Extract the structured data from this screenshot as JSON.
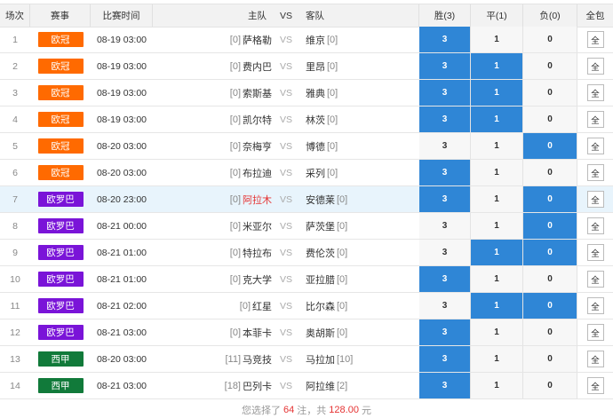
{
  "headers": {
    "index": "场次",
    "league": "赛事",
    "time": "比赛时间",
    "home": "主队",
    "vs": "VS",
    "away": "客队",
    "win": "胜(3)",
    "draw": "平(1)",
    "lose": "负(0)",
    "all": "全包"
  },
  "colors": {
    "ucl": "#ff6a00",
    "uel": "#7a14d8",
    "laliga": "#117a3a",
    "selected": "#2f86d6"
  },
  "rows": [
    {
      "idx": "1",
      "league": "欧冠",
      "lt": "ucl",
      "time": "08-19 03:00",
      "hr": "[0]",
      "home": "萨格勒",
      "away": "维京",
      "ar": "[0]",
      "win": "3",
      "draw": "1",
      "lose": "0",
      "all": "全",
      "sel": [
        true,
        false,
        false
      ],
      "hl": false,
      "red": false
    },
    {
      "idx": "2",
      "league": "欧冠",
      "lt": "ucl",
      "time": "08-19 03:00",
      "hr": "[0]",
      "home": "费内巴",
      "away": "里昂",
      "ar": "[0]",
      "win": "3",
      "draw": "1",
      "lose": "0",
      "all": "全",
      "sel": [
        true,
        true,
        false
      ],
      "hl": false,
      "red": false
    },
    {
      "idx": "3",
      "league": "欧冠",
      "lt": "ucl",
      "time": "08-19 03:00",
      "hr": "[0]",
      "home": "索斯基",
      "away": "雅典",
      "ar": "[0]",
      "win": "3",
      "draw": "1",
      "lose": "0",
      "all": "全",
      "sel": [
        true,
        true,
        false
      ],
      "hl": false,
      "red": false
    },
    {
      "idx": "4",
      "league": "欧冠",
      "lt": "ucl",
      "time": "08-19 03:00",
      "hr": "[0]",
      "home": "凯尔特",
      "away": "林茨",
      "ar": "[0]",
      "win": "3",
      "draw": "1",
      "lose": "0",
      "all": "全",
      "sel": [
        true,
        true,
        false
      ],
      "hl": false,
      "red": false
    },
    {
      "idx": "5",
      "league": "欧冠",
      "lt": "ucl",
      "time": "08-20 03:00",
      "hr": "[0]",
      "home": "奈梅亨",
      "away": "博德",
      "ar": "[0]",
      "win": "3",
      "draw": "1",
      "lose": "0",
      "all": "全",
      "sel": [
        false,
        false,
        true
      ],
      "hl": false,
      "red": false
    },
    {
      "idx": "6",
      "league": "欧冠",
      "lt": "ucl",
      "time": "08-20 03:00",
      "hr": "[0]",
      "home": "布拉迪",
      "away": "采列",
      "ar": "[0]",
      "win": "3",
      "draw": "1",
      "lose": "0",
      "all": "全",
      "sel": [
        true,
        false,
        false
      ],
      "hl": false,
      "red": false
    },
    {
      "idx": "7",
      "league": "欧罗巴",
      "lt": "uel",
      "time": "08-20 23:00",
      "hr": "[0]",
      "home": "阿拉木",
      "away": "安德莱",
      "ar": "[0]",
      "win": "3",
      "draw": "1",
      "lose": "0",
      "all": "全",
      "sel": [
        true,
        false,
        true
      ],
      "hl": true,
      "red": true
    },
    {
      "idx": "8",
      "league": "欧罗巴",
      "lt": "uel",
      "time": "08-21 00:00",
      "hr": "[0]",
      "home": "米亚尔",
      "away": "萨茨堡",
      "ar": "[0]",
      "win": "3",
      "draw": "1",
      "lose": "0",
      "all": "全",
      "sel": [
        false,
        false,
        true
      ],
      "hl": false,
      "red": false
    },
    {
      "idx": "9",
      "league": "欧罗巴",
      "lt": "uel",
      "time": "08-21 01:00",
      "hr": "[0]",
      "home": "特拉布",
      "away": "费伦茨",
      "ar": "[0]",
      "win": "3",
      "draw": "1",
      "lose": "0",
      "all": "全",
      "sel": [
        false,
        true,
        true
      ],
      "hl": false,
      "red": false
    },
    {
      "idx": "10",
      "league": "欧罗巴",
      "lt": "uel",
      "time": "08-21 01:00",
      "hr": "[0]",
      "home": "克大学",
      "away": "亚拉腊",
      "ar": "[0]",
      "win": "3",
      "draw": "1",
      "lose": "0",
      "all": "全",
      "sel": [
        true,
        false,
        false
      ],
      "hl": false,
      "red": false
    },
    {
      "idx": "11",
      "league": "欧罗巴",
      "lt": "uel",
      "time": "08-21 02:00",
      "hr": "[0]",
      "home": "红星",
      "away": "比尔森",
      "ar": "[0]",
      "win": "3",
      "draw": "1",
      "lose": "0",
      "all": "全",
      "sel": [
        false,
        true,
        true
      ],
      "hl": false,
      "red": false
    },
    {
      "idx": "12",
      "league": "欧罗巴",
      "lt": "uel",
      "time": "08-21 03:00",
      "hr": "[0]",
      "home": "本菲卡",
      "away": "奥胡斯",
      "ar": "[0]",
      "win": "3",
      "draw": "1",
      "lose": "0",
      "all": "全",
      "sel": [
        true,
        false,
        false
      ],
      "hl": false,
      "red": false
    },
    {
      "idx": "13",
      "league": "西甲",
      "lt": "laliga",
      "time": "08-20 03:00",
      "hr": "[11]",
      "home": "马竞技",
      "away": "马拉加",
      "ar": "[10]",
      "win": "3",
      "draw": "1",
      "lose": "0",
      "all": "全",
      "sel": [
        true,
        false,
        false
      ],
      "hl": false,
      "red": false
    },
    {
      "idx": "14",
      "league": "西甲",
      "lt": "laliga",
      "time": "08-21 03:00",
      "hr": "[18]",
      "home": "巴列卡",
      "away": "阿拉维",
      "ar": "[2]",
      "win": "3",
      "draw": "1",
      "lose": "0",
      "all": "全",
      "sel": [
        true,
        false,
        false
      ],
      "hl": false,
      "red": false
    }
  ],
  "footer": {
    "prefix": "您选择了",
    "count": "64",
    "mid": "注，共",
    "amount": "128.00",
    "suffix": "元"
  }
}
